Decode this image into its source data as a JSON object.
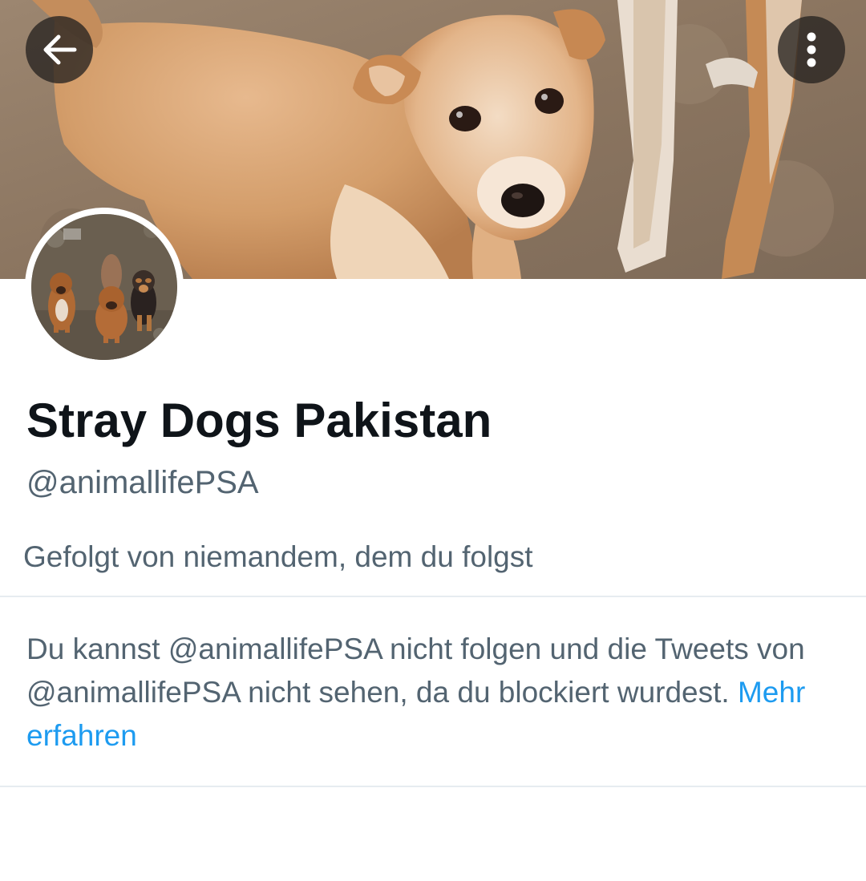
{
  "header": {
    "back_icon": "arrow-left-icon",
    "more_icon": "more-vertical-icon"
  },
  "profile": {
    "display_name": "Stray Dogs Pakistan",
    "handle": "@animallifePSA",
    "followed_by": "Gefolgt von niemandem, dem du folgst"
  },
  "blocked_notice": {
    "text": "Du kannst @animallifePSA nicht folgen und die Tweets von @animallifePSA nicht sehen, da du blockiert wurdest.",
    "learn_more": "Mehr erfahren"
  },
  "colors": {
    "name": "#0f1419",
    "secondary_text": "#536471",
    "link": "#1d9bf0",
    "divider": "#e6ecf0"
  }
}
